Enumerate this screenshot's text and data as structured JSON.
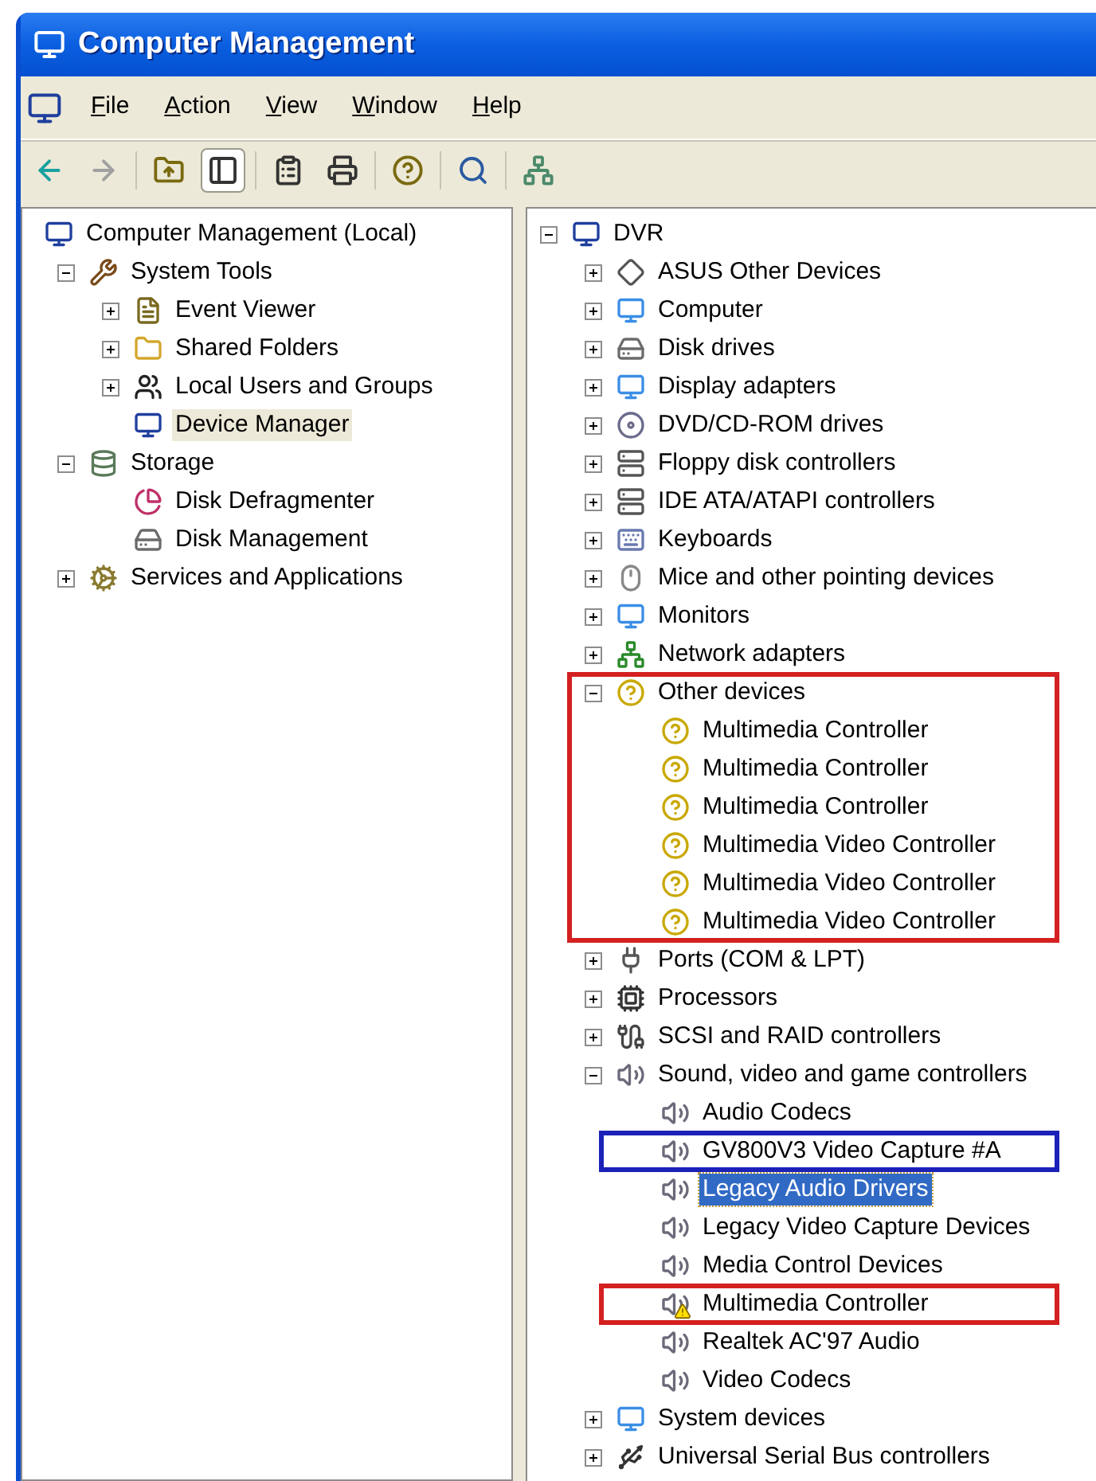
{
  "window": {
    "title": "Computer Management"
  },
  "menu": [
    {
      "label": "File"
    },
    {
      "label": "Action"
    },
    {
      "label": "View"
    },
    {
      "label": "Window"
    },
    {
      "label": "Help"
    }
  ],
  "toolbar": [
    {
      "kind": "back",
      "disabled": false,
      "pressed": false
    },
    {
      "kind": "forward",
      "disabled": true,
      "pressed": false
    },
    {
      "kind": "up",
      "disabled": false,
      "pressed": false
    },
    {
      "kind": "tree",
      "disabled": false,
      "pressed": true
    },
    {
      "kind": "properties",
      "disabled": false,
      "pressed": false
    },
    {
      "kind": "print",
      "disabled": false,
      "pressed": false
    },
    {
      "kind": "help",
      "disabled": false,
      "pressed": false
    },
    {
      "kind": "scan",
      "disabled": false,
      "pressed": false
    },
    {
      "kind": "network",
      "disabled": false,
      "pressed": false
    }
  ],
  "console_tree": {
    "focused": false,
    "items": [
      {
        "label": "Computer Management (Local)",
        "kind": "computer",
        "selected": false,
        "children": [
          {
            "label": "System Tools",
            "kind": "tools",
            "selected": false,
            "expanded": true,
            "children": [
              {
                "label": "Event Viewer",
                "kind": "log",
                "selected": false,
                "expanded": false
              },
              {
                "label": "Shared Folders",
                "kind": "folder",
                "selected": false,
                "expanded": false
              },
              {
                "label": "Local Users and Groups",
                "kind": "users",
                "selected": false,
                "expanded": false
              },
              {
                "label": "Device Manager",
                "kind": "computer",
                "selected": true
              }
            ]
          },
          {
            "label": "Storage",
            "kind": "storage",
            "selected": false,
            "expanded": true,
            "children": [
              {
                "label": "Disk Defragmenter",
                "kind": "defrag",
                "selected": false
              },
              {
                "label": "Disk Management",
                "kind": "disk",
                "selected": false
              }
            ]
          },
          {
            "label": "Services and Applications",
            "kind": "services",
            "selected": false,
            "expanded": false
          }
        ]
      }
    ]
  },
  "device_tree": {
    "focused": true,
    "items": [
      {
        "label": "DVR",
        "kind": "computer",
        "selected": false,
        "expanded": true,
        "children": [
          {
            "label": "ASUS Other Devices",
            "kind": "diamond",
            "selected": false,
            "expanded": false
          },
          {
            "label": "Computer",
            "kind": "pc",
            "selected": false,
            "expanded": false
          },
          {
            "label": "Disk drives",
            "kind": "disk",
            "selected": false,
            "expanded": false
          },
          {
            "label": "Display adapters",
            "kind": "monitor",
            "selected": false,
            "expanded": false
          },
          {
            "label": "DVD/CD-ROM drives",
            "kind": "dvd",
            "selected": false,
            "expanded": false
          },
          {
            "label": "Floppy disk controllers",
            "kind": "controller",
            "selected": false,
            "expanded": false
          },
          {
            "label": "IDE ATA/ATAPI controllers",
            "kind": "controller",
            "selected": false,
            "expanded": false
          },
          {
            "label": "Keyboards",
            "kind": "keyboard",
            "selected": false,
            "expanded": false
          },
          {
            "label": "Mice and other pointing devices",
            "kind": "mouse",
            "selected": false,
            "expanded": false
          },
          {
            "label": "Monitors",
            "kind": "monitor",
            "selected": false,
            "expanded": false
          },
          {
            "label": "Network adapters",
            "kind": "network",
            "selected": false,
            "expanded": false
          },
          {
            "label": "Other devices",
            "kind": "unknown",
            "selected": false,
            "expanded": true,
            "color": "#d42020",
            "children": [
              {
                "label": "Multimedia Controller",
                "kind": "unknown",
                "selected": false
              },
              {
                "label": "Multimedia Controller",
                "kind": "unknown",
                "selected": false
              },
              {
                "label": "Multimedia Controller",
                "kind": "unknown",
                "selected": false
              },
              {
                "label": "Multimedia Video Controller",
                "kind": "unknown",
                "selected": false
              },
              {
                "label": "Multimedia Video Controller",
                "kind": "unknown",
                "selected": false
              },
              {
                "label": "Multimedia Video Controller",
                "kind": "unknown",
                "selected": false
              }
            ]
          },
          {
            "label": "Ports (COM & LPT)",
            "kind": "port",
            "selected": false,
            "expanded": false
          },
          {
            "label": "Processors",
            "kind": "chip",
            "selected": false,
            "expanded": false
          },
          {
            "label": "SCSI and RAID controllers",
            "kind": "scsi",
            "selected": false,
            "expanded": false
          },
          {
            "label": "Sound, video and game controllers",
            "kind": "speaker",
            "selected": false,
            "expanded": true,
            "children": [
              {
                "label": "Audio Codecs",
                "kind": "speaker",
                "selected": false
              },
              {
                "label": "GV800V3 Video Capture #A",
                "kind": "speaker",
                "selected": false,
                "color": "#1c22b8"
              },
              {
                "label": "Legacy Audio Drivers",
                "kind": "speaker",
                "selected": true
              },
              {
                "label": "Legacy Video Capture Devices",
                "kind": "speaker",
                "selected": false
              },
              {
                "label": "Media Control Devices",
                "kind": "speaker",
                "selected": false
              },
              {
                "label": "Multimedia Controller",
                "kind": "speaker-warning",
                "selected": false,
                "color": "#d42020"
              },
              {
                "label": "Realtek AC'97 Audio",
                "kind": "speaker",
                "selected": false
              },
              {
                "label": "Video Codecs",
                "kind": "speaker",
                "selected": false
              }
            ]
          },
          {
            "label": "System devices",
            "kind": "pc",
            "selected": false,
            "expanded": false
          },
          {
            "label": "Universal Serial Bus controllers",
            "kind": "usb",
            "selected": false,
            "expanded": false
          }
        ]
      }
    ]
  }
}
